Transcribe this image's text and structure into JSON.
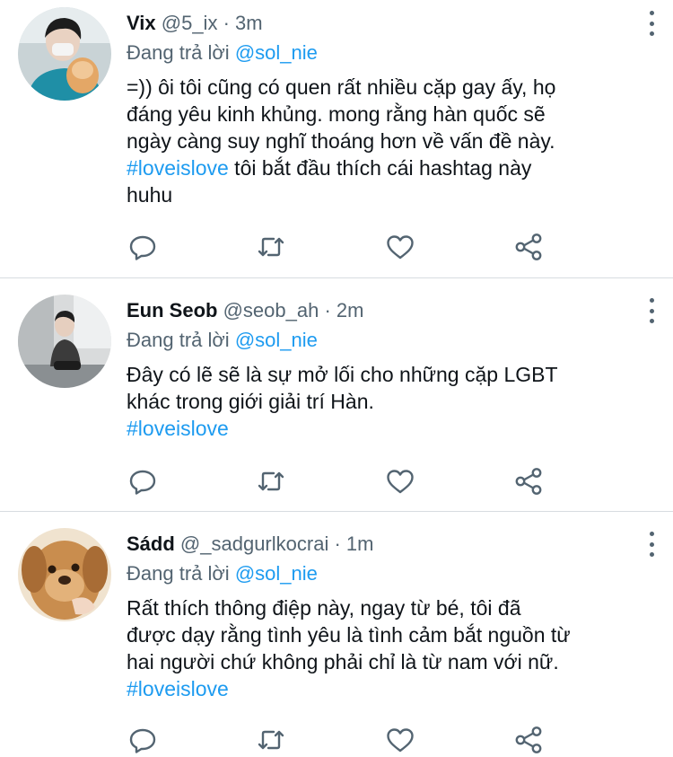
{
  "tweets": [
    {
      "name": "Vix",
      "handle": "@5_ix",
      "dot": "·",
      "time": "3m",
      "reply_prefix": "Đang trả lời",
      "reply_to": "@sol_nie",
      "text_line1": "=)) ôi tôi cũng có quen rất nhiều cặp gay ấy, họ",
      "text_line2": "đáng yêu kinh khủng. mong rằng hàn quốc sẽ",
      "text_line3": "ngày càng suy nghĩ thoáng hơn về vấn đề này.",
      "hashtag": "#loveislove",
      "text_line4_rest": " tôi bắt đầu thích cái hashtag này",
      "text_line5": "huhu"
    },
    {
      "name": "Eun Seob",
      "handle": "@seob_ah",
      "dot": "·",
      "time": "2m",
      "reply_prefix": "Đang trả lời",
      "reply_to": "@sol_nie",
      "text_line1": "Đây có lẽ sẽ là sự mở lối cho những cặp LGBT",
      "text_line2": "khác trong giới giải trí Hàn.",
      "hashtag": "#loveislove"
    },
    {
      "name": "Sádd",
      "handle": "@_sadgurlkocrai",
      "dot": "·",
      "time": "1m",
      "reply_prefix": "Đang trả lời",
      "reply_to": "@sol_nie",
      "text_line1": "Rất thích thông điệp này, ngay từ bé, tôi đã",
      "text_line2": "được dạy rằng tình yêu là tình cảm bắt nguồn từ",
      "text_line3": "hai người chứ không phải chỉ là từ nam với nữ.",
      "hashtag": "#loveislove"
    }
  ],
  "icons": {
    "reply": "speech-bubble",
    "retweet": "retweet-arrows",
    "like": "heart",
    "share": "share-nodes",
    "more": "vertical-dots"
  },
  "colors": {
    "link": "#1d9bf0",
    "muted": "#536471",
    "text": "#0f1419",
    "divider": "#d7dce0"
  }
}
